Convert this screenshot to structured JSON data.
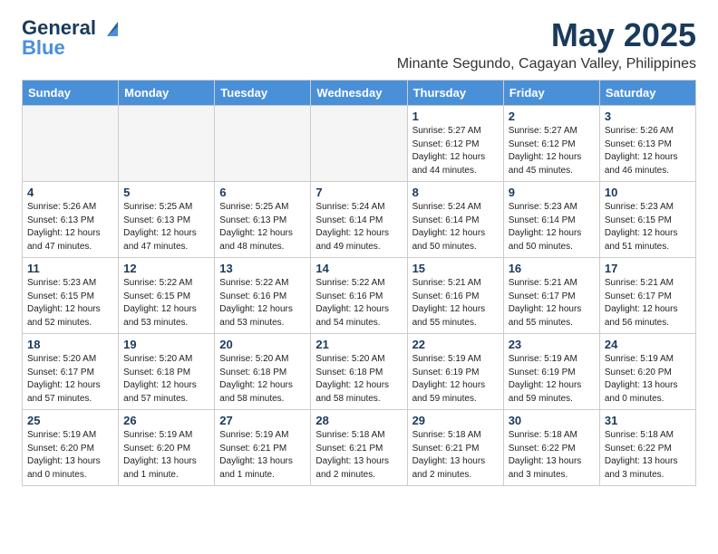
{
  "header": {
    "logo_general": "General",
    "logo_blue": "Blue",
    "main_title": "May 2025",
    "subtitle": "Minante Segundo, Cagayan Valley, Philippines"
  },
  "calendar": {
    "days_of_week": [
      "Sunday",
      "Monday",
      "Tuesday",
      "Wednesday",
      "Thursday",
      "Friday",
      "Saturday"
    ],
    "weeks": [
      [
        {
          "day": "",
          "info": ""
        },
        {
          "day": "",
          "info": ""
        },
        {
          "day": "",
          "info": ""
        },
        {
          "day": "",
          "info": ""
        },
        {
          "day": "1",
          "info": "Sunrise: 5:27 AM\nSunset: 6:12 PM\nDaylight: 12 hours\nand 44 minutes."
        },
        {
          "day": "2",
          "info": "Sunrise: 5:27 AM\nSunset: 6:12 PM\nDaylight: 12 hours\nand 45 minutes."
        },
        {
          "day": "3",
          "info": "Sunrise: 5:26 AM\nSunset: 6:13 PM\nDaylight: 12 hours\nand 46 minutes."
        }
      ],
      [
        {
          "day": "4",
          "info": "Sunrise: 5:26 AM\nSunset: 6:13 PM\nDaylight: 12 hours\nand 47 minutes."
        },
        {
          "day": "5",
          "info": "Sunrise: 5:25 AM\nSunset: 6:13 PM\nDaylight: 12 hours\nand 47 minutes."
        },
        {
          "day": "6",
          "info": "Sunrise: 5:25 AM\nSunset: 6:13 PM\nDaylight: 12 hours\nand 48 minutes."
        },
        {
          "day": "7",
          "info": "Sunrise: 5:24 AM\nSunset: 6:14 PM\nDaylight: 12 hours\nand 49 minutes."
        },
        {
          "day": "8",
          "info": "Sunrise: 5:24 AM\nSunset: 6:14 PM\nDaylight: 12 hours\nand 50 minutes."
        },
        {
          "day": "9",
          "info": "Sunrise: 5:23 AM\nSunset: 6:14 PM\nDaylight: 12 hours\nand 50 minutes."
        },
        {
          "day": "10",
          "info": "Sunrise: 5:23 AM\nSunset: 6:15 PM\nDaylight: 12 hours\nand 51 minutes."
        }
      ],
      [
        {
          "day": "11",
          "info": "Sunrise: 5:23 AM\nSunset: 6:15 PM\nDaylight: 12 hours\nand 52 minutes."
        },
        {
          "day": "12",
          "info": "Sunrise: 5:22 AM\nSunset: 6:15 PM\nDaylight: 12 hours\nand 53 minutes."
        },
        {
          "day": "13",
          "info": "Sunrise: 5:22 AM\nSunset: 6:16 PM\nDaylight: 12 hours\nand 53 minutes."
        },
        {
          "day": "14",
          "info": "Sunrise: 5:22 AM\nSunset: 6:16 PM\nDaylight: 12 hours\nand 54 minutes."
        },
        {
          "day": "15",
          "info": "Sunrise: 5:21 AM\nSunset: 6:16 PM\nDaylight: 12 hours\nand 55 minutes."
        },
        {
          "day": "16",
          "info": "Sunrise: 5:21 AM\nSunset: 6:17 PM\nDaylight: 12 hours\nand 55 minutes."
        },
        {
          "day": "17",
          "info": "Sunrise: 5:21 AM\nSunset: 6:17 PM\nDaylight: 12 hours\nand 56 minutes."
        }
      ],
      [
        {
          "day": "18",
          "info": "Sunrise: 5:20 AM\nSunset: 6:17 PM\nDaylight: 12 hours\nand 57 minutes."
        },
        {
          "day": "19",
          "info": "Sunrise: 5:20 AM\nSunset: 6:18 PM\nDaylight: 12 hours\nand 57 minutes."
        },
        {
          "day": "20",
          "info": "Sunrise: 5:20 AM\nSunset: 6:18 PM\nDaylight: 12 hours\nand 58 minutes."
        },
        {
          "day": "21",
          "info": "Sunrise: 5:20 AM\nSunset: 6:18 PM\nDaylight: 12 hours\nand 58 minutes."
        },
        {
          "day": "22",
          "info": "Sunrise: 5:19 AM\nSunset: 6:19 PM\nDaylight: 12 hours\nand 59 minutes."
        },
        {
          "day": "23",
          "info": "Sunrise: 5:19 AM\nSunset: 6:19 PM\nDaylight: 12 hours\nand 59 minutes."
        },
        {
          "day": "24",
          "info": "Sunrise: 5:19 AM\nSunset: 6:20 PM\nDaylight: 13 hours\nand 0 minutes."
        }
      ],
      [
        {
          "day": "25",
          "info": "Sunrise: 5:19 AM\nSunset: 6:20 PM\nDaylight: 13 hours\nand 0 minutes."
        },
        {
          "day": "26",
          "info": "Sunrise: 5:19 AM\nSunset: 6:20 PM\nDaylight: 13 hours\nand 1 minute."
        },
        {
          "day": "27",
          "info": "Sunrise: 5:19 AM\nSunset: 6:21 PM\nDaylight: 13 hours\nand 1 minute."
        },
        {
          "day": "28",
          "info": "Sunrise: 5:18 AM\nSunset: 6:21 PM\nDaylight: 13 hours\nand 2 minutes."
        },
        {
          "day": "29",
          "info": "Sunrise: 5:18 AM\nSunset: 6:21 PM\nDaylight: 13 hours\nand 2 minutes."
        },
        {
          "day": "30",
          "info": "Sunrise: 5:18 AM\nSunset: 6:22 PM\nDaylight: 13 hours\nand 3 minutes."
        },
        {
          "day": "31",
          "info": "Sunrise: 5:18 AM\nSunset: 6:22 PM\nDaylight: 13 hours\nand 3 minutes."
        }
      ]
    ]
  }
}
